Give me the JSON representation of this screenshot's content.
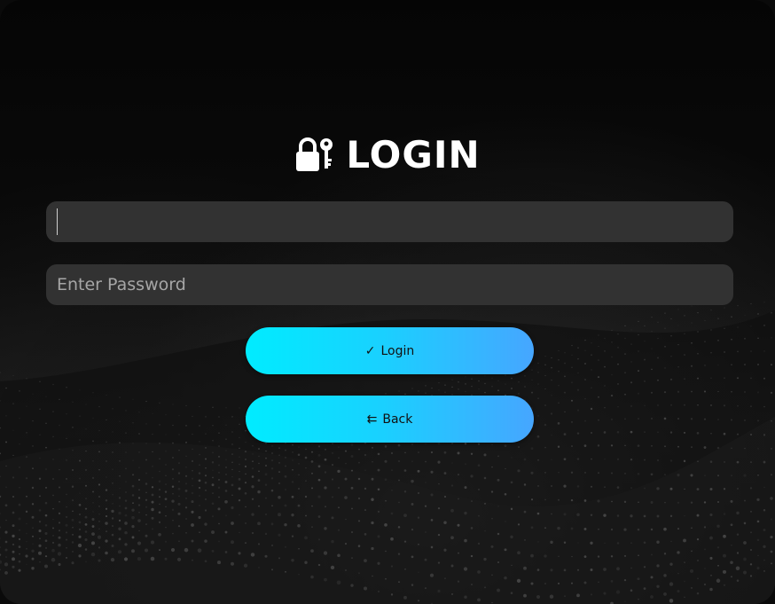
{
  "login": {
    "title": "LOGIN",
    "title_icon": "lock-key-icon",
    "username_field": {
      "value": "",
      "placeholder": ""
    },
    "password_field": {
      "value": "",
      "placeholder": "Enter Password"
    },
    "login_button": {
      "icon": "✓",
      "label": "Login"
    },
    "back_button": {
      "icon": "⇇",
      "label": "Back"
    }
  },
  "colors": {
    "background": "#0a0a0a",
    "field_bg": "#323232",
    "button_gradient_start": "#00ecff",
    "button_gradient_end": "#46a6ff",
    "title": "#ffffff"
  }
}
